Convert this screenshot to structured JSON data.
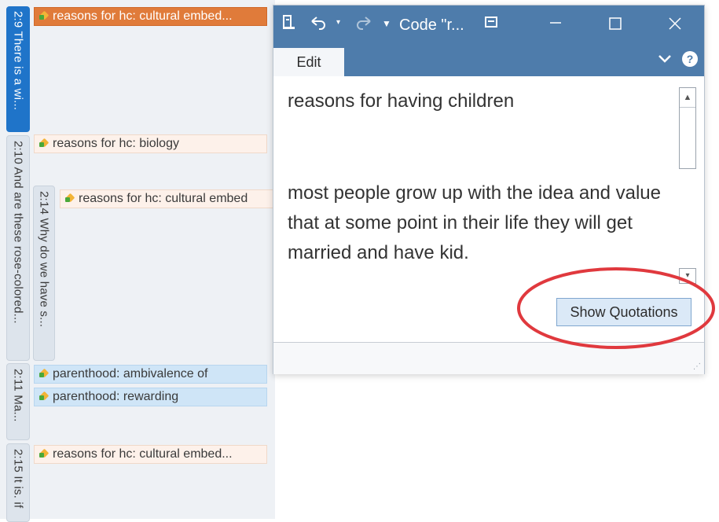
{
  "margin": {
    "docs": [
      {
        "label": "2:9 There is a wi...",
        "style": "blue"
      },
      {
        "label": "2:10 And are these rose-colored...",
        "style": "gray"
      },
      {
        "label": "2:14 Why do we have s...",
        "style": "gray"
      },
      {
        "label": "2:11 Ma...",
        "style": "gray"
      },
      {
        "label": "2:15 It is. if",
        "style": "gray"
      }
    ],
    "codes": [
      {
        "label": "reasons for hc: cultural embed...",
        "style": "orange"
      },
      {
        "label": "reasons for hc: biology",
        "style": "peach"
      },
      {
        "label": "reasons for hc: cultural embed",
        "style": "peach"
      },
      {
        "label": "parenthood: ambivalence of",
        "style": "blue"
      },
      {
        "label": "parenthood: rewarding",
        "style": "blue"
      },
      {
        "label": "reasons for hc: cultural embed...",
        "style": "peach"
      }
    ]
  },
  "window": {
    "title": "Code \"r...",
    "tab_edit": "Edit",
    "code_name": "reasons for having children",
    "comment": "most people grow up with the idea and value that at some point in their life they will get married and have kid.",
    "show_quotations": "Show Quotations"
  },
  "colors": {
    "titlebar": "#4e7cab",
    "doc_selected": "#1f74c9",
    "code_selected": "#e07b3a",
    "annotation": "#e0393e"
  }
}
